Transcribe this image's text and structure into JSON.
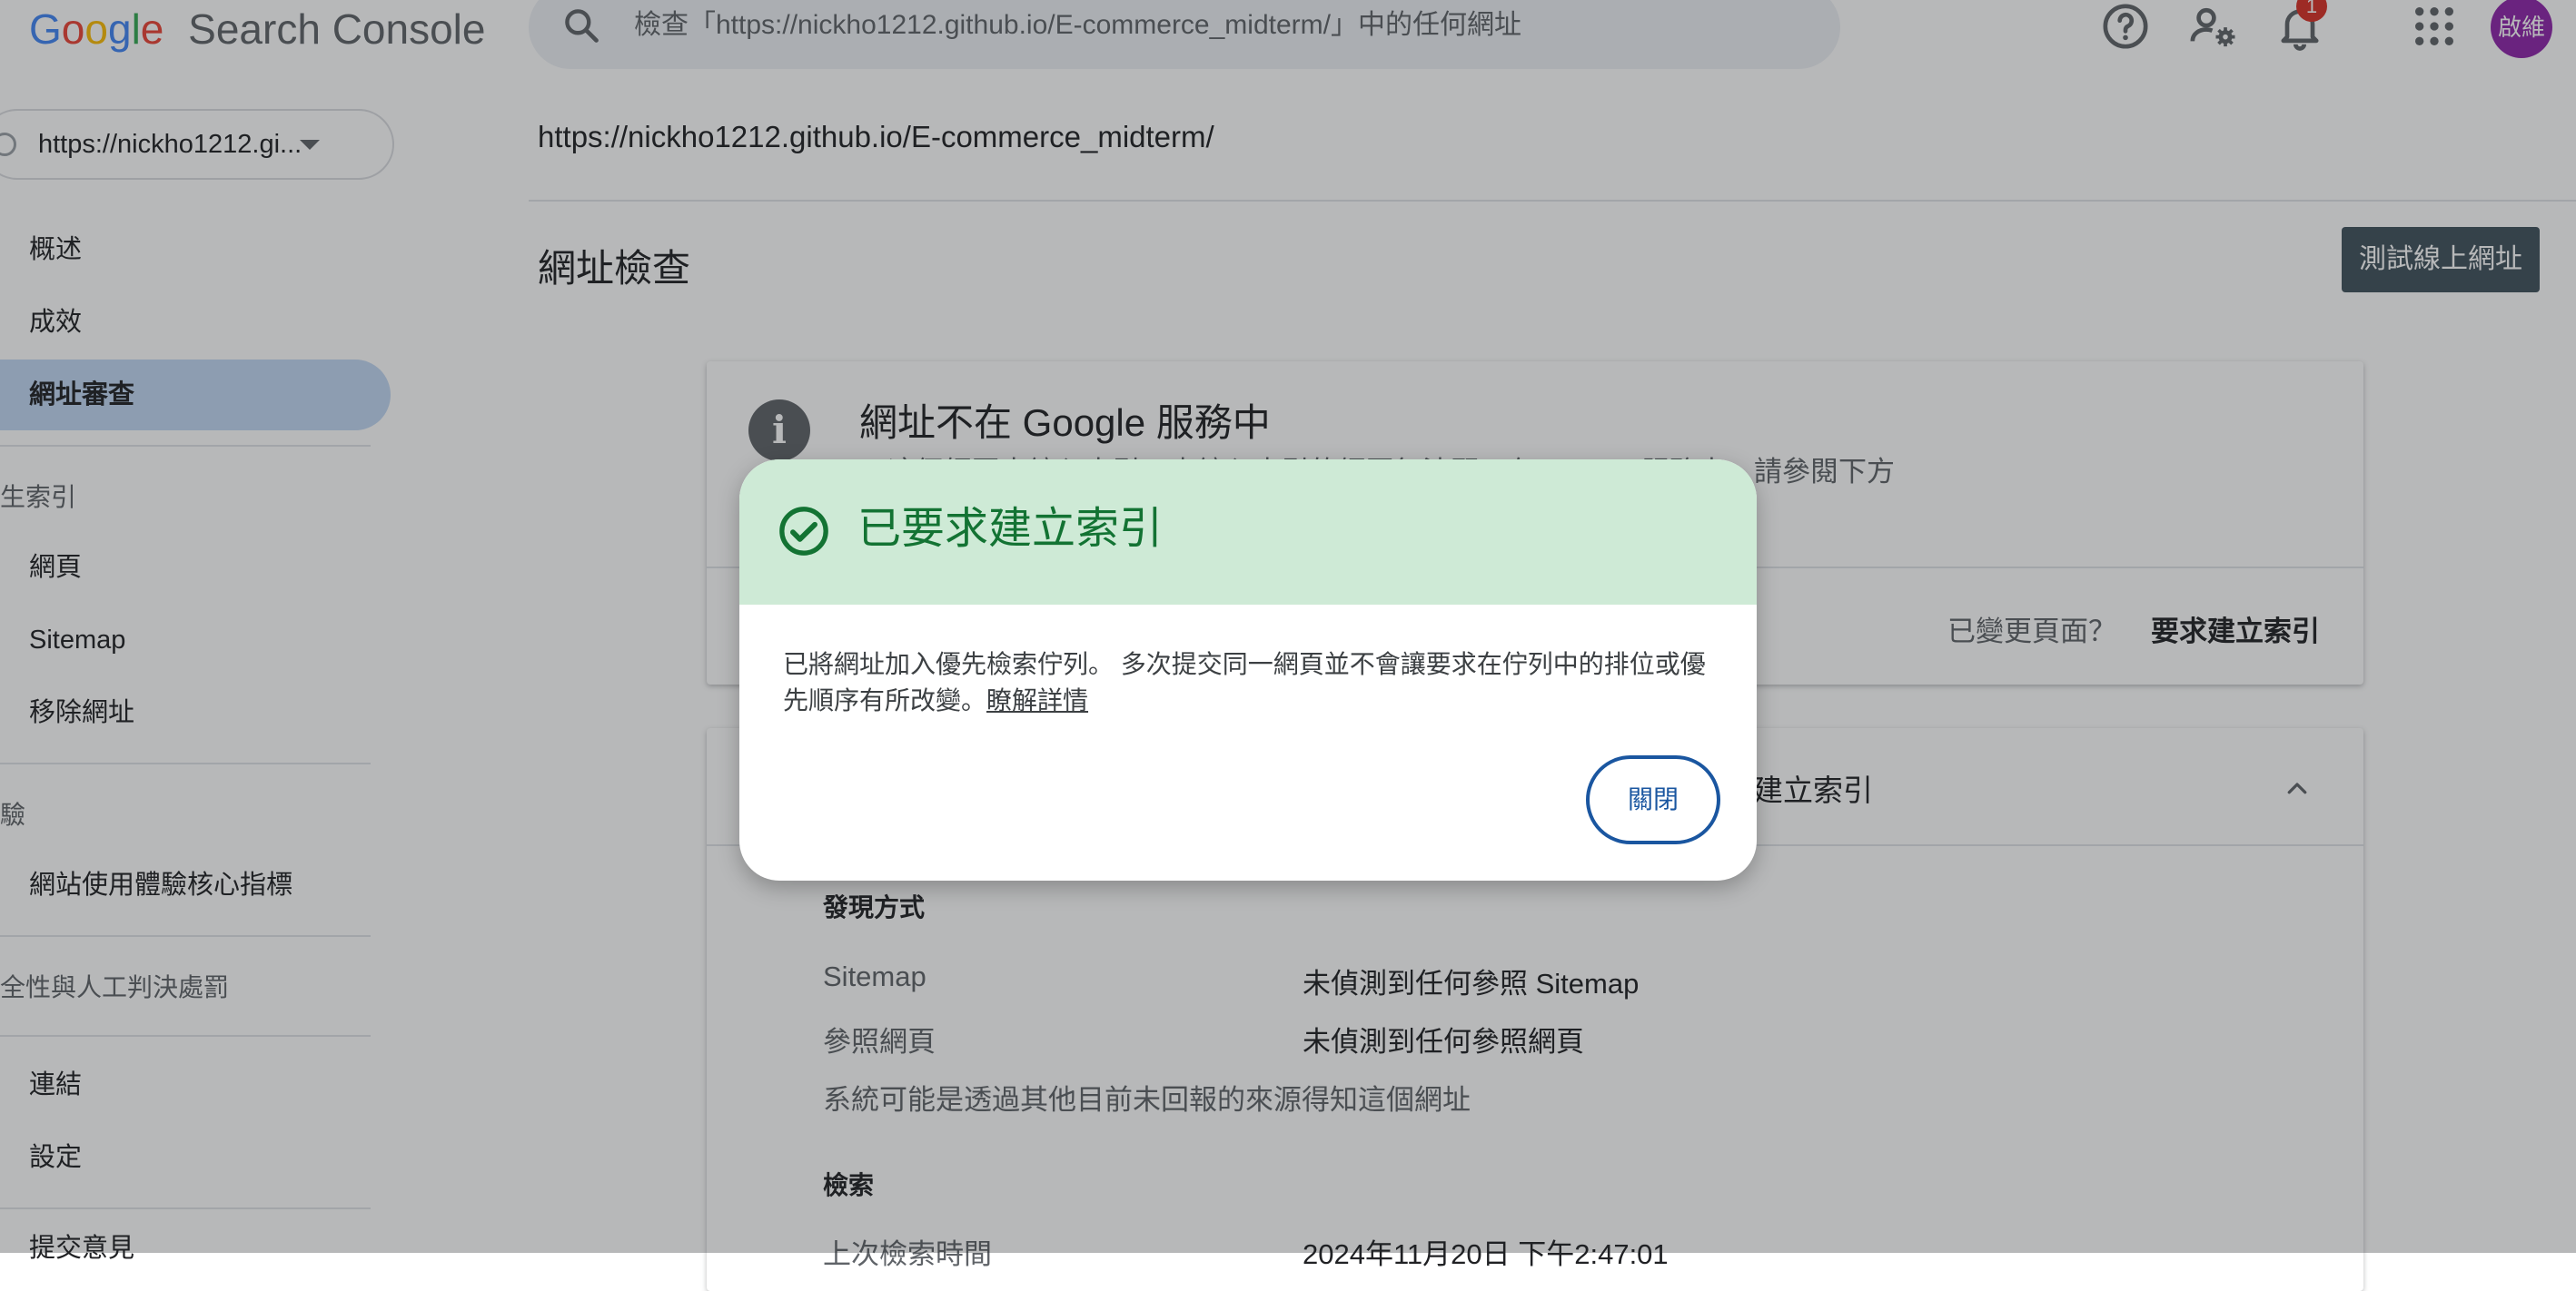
{
  "header": {
    "logo_letters": [
      "G",
      "o",
      "o",
      "g",
      "l",
      "e"
    ],
    "product": "Search Console",
    "search_placeholder": "檢查「https://nickho1212.github.io/E-commerce_midterm/」中的任何網址",
    "notification_count": "1",
    "avatar_text": "啟維",
    "icons": [
      "search-icon",
      "help-icon",
      "account-settings-icon",
      "notifications-icon",
      "apps-grid-icon"
    ]
  },
  "sidebar": {
    "property": "https://nickho1212.gi...",
    "items_top": [
      {
        "label": "概述"
      },
      {
        "label": "成效"
      },
      {
        "label": "網址審查",
        "active": true
      }
    ],
    "section_index": "產生索引",
    "items_index": [
      {
        "label": "網頁"
      },
      {
        "label": "Sitemap"
      },
      {
        "label": "移除網址"
      }
    ],
    "section_experience": "體驗",
    "items_experience": [
      {
        "label": "網站使用體驗核心指標"
      }
    ],
    "section_security": "安全性與人工判決處罰",
    "items_bottom": [
      {
        "label": "連結"
      },
      {
        "label": "設定"
      },
      {
        "label": "提交意見"
      }
    ]
  },
  "main": {
    "url": "https://nickho1212.github.io/E-commerce_midterm/",
    "page_title": "網址檢查",
    "test_live_button": "測試線上網址",
    "status_card": {
      "title": "網址不在 Google 服務中",
      "description": "這個網頁未編入索引。未編入索引的網頁無法顯示在 Google 服務中。請參閱下方",
      "changed_prompt": "已變更頁面？",
      "request_link": "要求建立索引"
    },
    "detail_card": {
      "title": "建立索引",
      "discovery_label": "發現方式",
      "rows": [
        {
          "label": "Sitemap",
          "value": "未偵測到任何參照 Sitemap"
        },
        {
          "label": "參照網頁",
          "value": "未偵測到任何參照網頁"
        }
      ],
      "note": "系統可能是透過其他目前未回報的來源得知這個網址",
      "crawl_label": "檢索",
      "last_crawl_label": "上次檢索時間",
      "last_crawl_value": "2024年11月20日 下午2:47:01"
    }
  },
  "dialog": {
    "title": "已要求建立索引",
    "body_line1": "已將網址加入優先檢索佇列。 多次提交同一網頁並不會讓要求在佇列中的排位或優",
    "body_line2": "先順序有所改變。",
    "learn_more": "瞭解詳情",
    "close_button": "關閉"
  },
  "colors": {
    "dialog_header_bg": "#ceead6",
    "dialog_title": "#137333",
    "active_nav_bg": "#c2d7f3",
    "test_button_bg": "#40515c",
    "close_button_border": "#1a56a0",
    "avatar_bg": "#8e24aa"
  }
}
